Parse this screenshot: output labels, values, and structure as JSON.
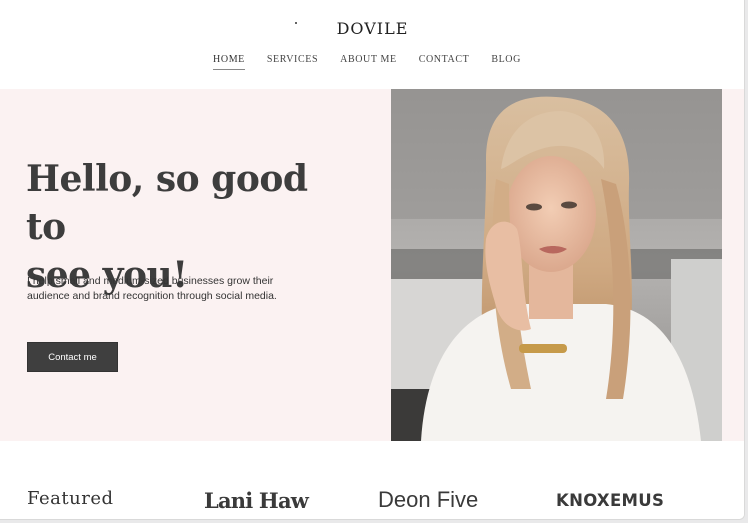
{
  "header": {
    "logo": "DOVILE",
    "nav": [
      {
        "label": "HOME",
        "active": true
      },
      {
        "label": "SERVICES"
      },
      {
        "label": "ABOUT ME"
      },
      {
        "label": "CONTACT"
      },
      {
        "label": "BLOG"
      }
    ]
  },
  "hero": {
    "title_line1": "Hello, so good to",
    "title_line2": "see you!",
    "text_line1": "I help small and medium-sized businesses grow their",
    "text_line2": "audience and brand recognition through social media.",
    "cta_label": "Contact me",
    "background_color": "#fbf2f2"
  },
  "featured": {
    "label": "Featured",
    "brands": [
      "Lani Haw",
      "Deon Five",
      "KNOXEMUS"
    ]
  },
  "colors": {
    "accent_dark": "#3f3f3f",
    "text": "#3d3d3d"
  }
}
